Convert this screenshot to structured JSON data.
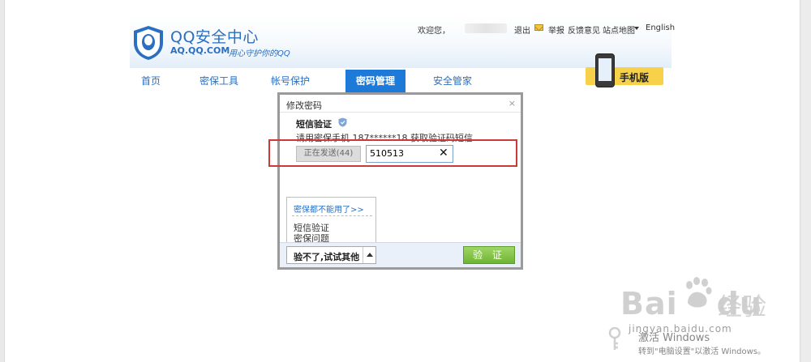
{
  "brand": {
    "title": "QQ安全中心",
    "domain": "AQ.QQ.COM",
    "slogan": "用心守护你的QQ"
  },
  "top_links": {
    "welcome": "欢迎您，",
    "logout": "退出",
    "report": "举报",
    "feedback": "反馈意见",
    "sitemap": "站点地图",
    "english": "English"
  },
  "nav": {
    "items": [
      {
        "label": "首页"
      },
      {
        "label": "密保工具"
      },
      {
        "label": "帐号保护"
      },
      {
        "label": "密码管理"
      },
      {
        "label": "安全管家"
      }
    ],
    "active_index": 3
  },
  "mobile_badge": {
    "label": "手机版"
  },
  "dialog": {
    "title": "修改密码",
    "close": "×",
    "method_label": "短信验证",
    "description": "请用密保手机 187******18 获取验证码短信",
    "send_button": "正在发送(44)",
    "code_value": "510513",
    "clear": "✕",
    "menu": {
      "more": "密保都不能用了>>",
      "items": [
        "短信验证",
        "密保问题"
      ]
    },
    "fallback_button": "验不了,试试其他",
    "verify_button": "验 证"
  },
  "watermark": {
    "baidu_word": "Bai",
    "baidu_du": "du",
    "baidu_cn": "经验",
    "url": "jingyan.baidu.com"
  },
  "os_overlay": {
    "line1": "激活 Windows",
    "line2": "转到\"电脑设置\"以激活 Windows。"
  },
  "colors": {
    "brand_blue": "#2a6fc0",
    "nav_active": "#1d7ad8",
    "highlight_red": "#c93a3a",
    "verify_green": "#6eb435"
  }
}
